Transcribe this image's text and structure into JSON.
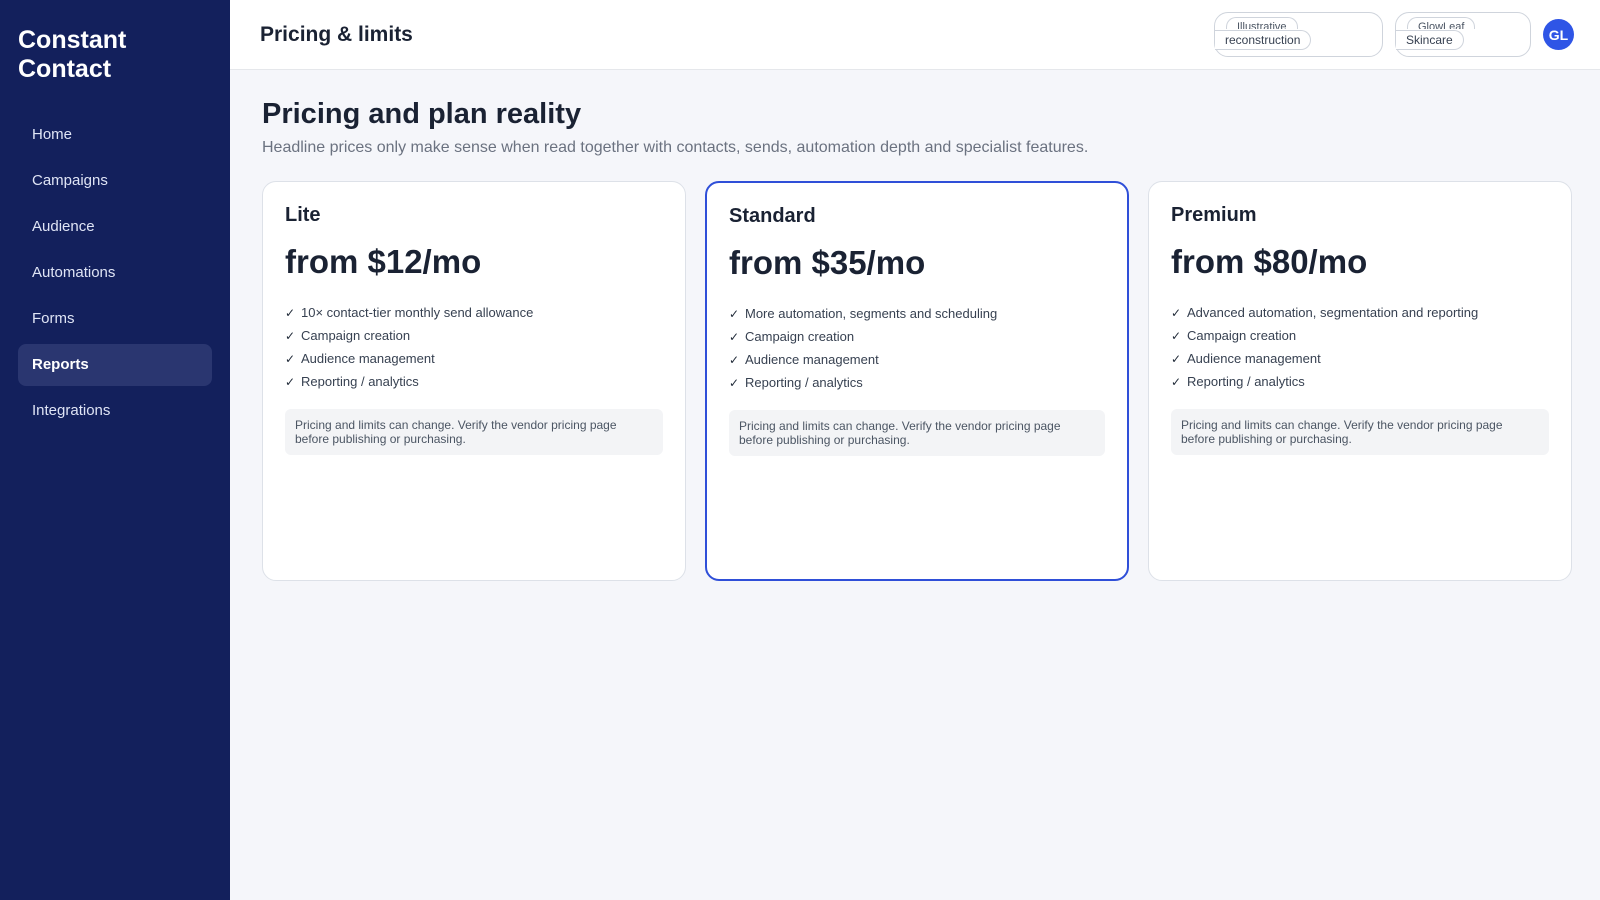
{
  "sidebar": {
    "brand": "Constant\nContact",
    "items": [
      {
        "label": "Home"
      },
      {
        "label": "Campaigns"
      },
      {
        "label": "Audience"
      },
      {
        "label": "Automations"
      },
      {
        "label": "Forms"
      },
      {
        "label": "Reports",
        "active": true
      },
      {
        "label": "Integrations"
      }
    ]
  },
  "header": {
    "title": "Pricing & limits",
    "pill1": {
      "line1": "Illustrative",
      "line2": "reconstruction"
    },
    "pill2": {
      "line1": "GlowLeaf",
      "line2": "Skincare"
    },
    "avatar": "GL"
  },
  "main": {
    "title": "Pricing and plan reality",
    "subtitle": "Headline prices only make sense when read together with contacts, sends, automation depth and specialist features.",
    "plans": [
      {
        "name": "Lite",
        "price": "from $12/mo",
        "features": [
          "10× contact-tier monthly send allowance",
          "Campaign creation",
          "Audience management",
          "Reporting / analytics"
        ],
        "note": "Pricing and limits can change. Verify the vendor pricing page before publishing or purchasing."
      },
      {
        "name": "Standard",
        "price": "from $35/mo",
        "featured": true,
        "features": [
          "More automation, segments and scheduling",
          "Campaign creation",
          "Audience management",
          "Reporting / analytics"
        ],
        "note": "Pricing and limits can change. Verify the vendor pricing page before publishing or purchasing."
      },
      {
        "name": "Premium",
        "price": "from $80/mo",
        "features": [
          "Advanced automation, segmentation and reporting",
          "Campaign creation",
          "Audience management",
          "Reporting / analytics"
        ],
        "note": "Pricing and limits can change. Verify the vendor pricing page before publishing or purchasing."
      }
    ],
    "check_icon": "✓"
  },
  "colors": {
    "sidebar_bg": "#13205c",
    "accent": "#2f4fd8",
    "avatar_bg": "#2f55e6"
  }
}
